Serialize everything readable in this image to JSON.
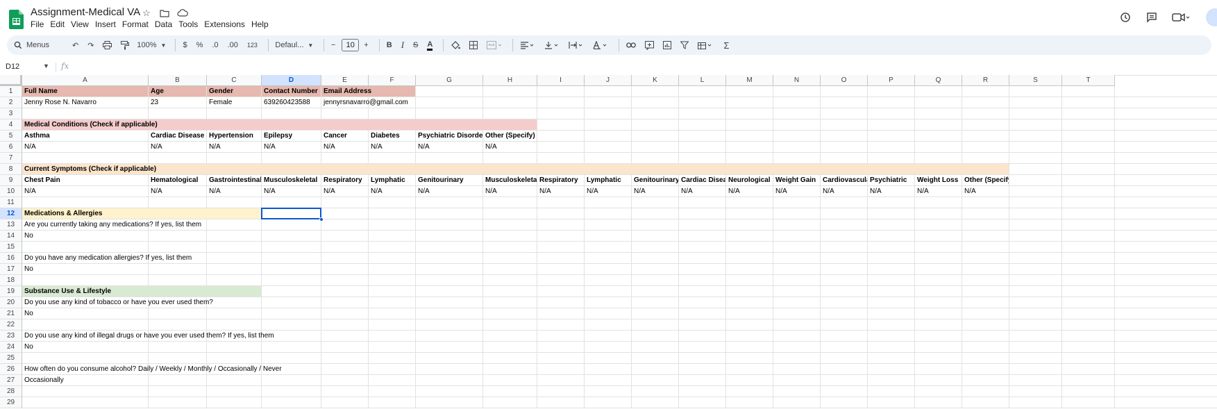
{
  "app": {
    "title": "Assignment-Medical VA",
    "menu": [
      "File",
      "Edit",
      "View",
      "Insert",
      "Format",
      "Data",
      "Tools",
      "Extensions",
      "Help"
    ]
  },
  "toolbar": {
    "search_label": "Menus",
    "zoom": "100%",
    "currency": "$",
    "percent": "%",
    "dec_decrease": ".0",
    "dec_increase": ".00",
    "number_format": "123",
    "font": "Defaul...",
    "font_size": "10",
    "bold": "B",
    "italic": "I",
    "strike": "S",
    "text_color": "A"
  },
  "formula_bar": {
    "cell_ref": "D12",
    "fx": "fx",
    "value": ""
  },
  "grid": {
    "columns": [
      "A",
      "B",
      "C",
      "D",
      "E",
      "F",
      "G",
      "H",
      "I",
      "J",
      "K",
      "L",
      "M",
      "N",
      "O",
      "P",
      "Q",
      "R",
      "S",
      "T"
    ],
    "selected_column": "D",
    "selected_row": 12,
    "rows": 29,
    "cells": [
      {
        "row": 1,
        "col": 0,
        "text": "Full Name",
        "bold": true,
        "fill": "red"
      },
      {
        "row": 1,
        "col": 1,
        "text": "Age",
        "bold": true,
        "fill": "red"
      },
      {
        "row": 1,
        "col": 2,
        "text": "Gender",
        "bold": true,
        "fill": "red"
      },
      {
        "row": 1,
        "col": 3,
        "text": "Contact Number",
        "bold": true,
        "fill": "red"
      },
      {
        "row": 1,
        "col": 4,
        "text": "Email Address",
        "bold": true,
        "fill": "red",
        "span": 2
      },
      {
        "row": 2,
        "col": 0,
        "text": "Jenny Rose N. Navarro"
      },
      {
        "row": 2,
        "col": 1,
        "text": "23"
      },
      {
        "row": 2,
        "col": 2,
        "text": "Female"
      },
      {
        "row": 2,
        "col": 3,
        "text": "639260423588"
      },
      {
        "row": 2,
        "col": 4,
        "text": "jennyrsnavarro@gmail.com",
        "overflow": true
      },
      {
        "row": 4,
        "col": 0,
        "text": "Medical Conditions (Check if applicable)",
        "bold": true,
        "fill": "pink",
        "span": 8
      },
      {
        "row": 5,
        "col": 0,
        "text": "Asthma",
        "bold": true
      },
      {
        "row": 5,
        "col": 1,
        "text": "Cardiac Disease",
        "bold": true
      },
      {
        "row": 5,
        "col": 2,
        "text": "Hypertension",
        "bold": true
      },
      {
        "row": 5,
        "col": 3,
        "text": "Epilepsy",
        "bold": true
      },
      {
        "row": 5,
        "col": 4,
        "text": "Cancer",
        "bold": true
      },
      {
        "row": 5,
        "col": 5,
        "text": "Diabetes",
        "bold": true
      },
      {
        "row": 5,
        "col": 6,
        "text": "Psychiatric Disorder",
        "bold": true
      },
      {
        "row": 5,
        "col": 7,
        "text": "Other (Specify)",
        "bold": true
      },
      {
        "row": 6,
        "col": 0,
        "text": "N/A"
      },
      {
        "row": 6,
        "col": 1,
        "text": "N/A"
      },
      {
        "row": 6,
        "col": 2,
        "text": "N/A"
      },
      {
        "row": 6,
        "col": 3,
        "text": "N/A"
      },
      {
        "row": 6,
        "col": 4,
        "text": "N/A"
      },
      {
        "row": 6,
        "col": 5,
        "text": "N/A"
      },
      {
        "row": 6,
        "col": 6,
        "text": "N/A"
      },
      {
        "row": 6,
        "col": 7,
        "text": "N/A"
      },
      {
        "row": 8,
        "col": 0,
        "text": "Current Symptoms (Check if applicable)",
        "bold": true,
        "fill": "orange",
        "span": 18
      },
      {
        "row": 9,
        "col": 0,
        "text": "Chest Pain",
        "bold": true
      },
      {
        "row": 9,
        "col": 1,
        "text": "Hematological",
        "bold": true
      },
      {
        "row": 9,
        "col": 2,
        "text": "Gastrointestinal",
        "bold": true
      },
      {
        "row": 9,
        "col": 3,
        "text": "Musculoskeletal",
        "bold": true
      },
      {
        "row": 9,
        "col": 4,
        "text": "Respiratory",
        "bold": true
      },
      {
        "row": 9,
        "col": 5,
        "text": "Lymphatic",
        "bold": true
      },
      {
        "row": 9,
        "col": 6,
        "text": "Genitourinary",
        "bold": true
      },
      {
        "row": 9,
        "col": 7,
        "text": "Musculoskeletal",
        "bold": true
      },
      {
        "row": 9,
        "col": 8,
        "text": "Respiratory",
        "bold": true
      },
      {
        "row": 9,
        "col": 9,
        "text": "Lymphatic",
        "bold": true
      },
      {
        "row": 9,
        "col": 10,
        "text": "Genitourinary",
        "bold": true
      },
      {
        "row": 9,
        "col": 11,
        "text": "Cardiac Disease",
        "bold": true
      },
      {
        "row": 9,
        "col": 12,
        "text": "Neurological",
        "bold": true
      },
      {
        "row": 9,
        "col": 13,
        "text": "Weight Gain",
        "bold": true
      },
      {
        "row": 9,
        "col": 14,
        "text": "Cardiovascular",
        "bold": true
      },
      {
        "row": 9,
        "col": 15,
        "text": "Psychiatric",
        "bold": true
      },
      {
        "row": 9,
        "col": 16,
        "text": "Weight Loss",
        "bold": true
      },
      {
        "row": 9,
        "col": 17,
        "text": "Other (Specify)",
        "bold": true
      },
      {
        "row": 10,
        "col": 0,
        "text": "N/A"
      },
      {
        "row": 10,
        "col": 1,
        "text": "N/A"
      },
      {
        "row": 10,
        "col": 2,
        "text": "N/A"
      },
      {
        "row": 10,
        "col": 3,
        "text": "N/A"
      },
      {
        "row": 10,
        "col": 4,
        "text": "N/A"
      },
      {
        "row": 10,
        "col": 5,
        "text": "N/A"
      },
      {
        "row": 10,
        "col": 6,
        "text": "N/A"
      },
      {
        "row": 10,
        "col": 7,
        "text": "N/A"
      },
      {
        "row": 10,
        "col": 8,
        "text": "N/A"
      },
      {
        "row": 10,
        "col": 9,
        "text": "N/A"
      },
      {
        "row": 10,
        "col": 10,
        "text": "N/A"
      },
      {
        "row": 10,
        "col": 11,
        "text": "N/A"
      },
      {
        "row": 10,
        "col": 12,
        "text": "N/A"
      },
      {
        "row": 10,
        "col": 13,
        "text": "N/A"
      },
      {
        "row": 10,
        "col": 14,
        "text": "N/A"
      },
      {
        "row": 10,
        "col": 15,
        "text": "N/A"
      },
      {
        "row": 10,
        "col": 16,
        "text": "N/A"
      },
      {
        "row": 10,
        "col": 17,
        "text": "N/A"
      },
      {
        "row": 12,
        "col": 0,
        "text": "Medications & Allergies",
        "bold": true,
        "fill": "yellow",
        "span": 3
      },
      {
        "row": 13,
        "col": 0,
        "text": "Are you currently taking any medications? If yes, list them",
        "overflow": true
      },
      {
        "row": 14,
        "col": 0,
        "text": "No"
      },
      {
        "row": 16,
        "col": 0,
        "text": "Do you have any medication allergies? If yes, list them",
        "overflow": true
      },
      {
        "row": 17,
        "col": 0,
        "text": "No"
      },
      {
        "row": 19,
        "col": 0,
        "text": "Substance Use & Lifestyle",
        "bold": true,
        "fill": "green",
        "span": 3
      },
      {
        "row": 20,
        "col": 0,
        "text": "Do you use any kind of tobacco or have you ever used them?",
        "overflow": true
      },
      {
        "row": 21,
        "col": 0,
        "text": "No"
      },
      {
        "row": 23,
        "col": 0,
        "text": "Do you use any kind of illegal drugs or have you ever used them? If yes, list them",
        "overflow": true
      },
      {
        "row": 24,
        "col": 0,
        "text": "No"
      },
      {
        "row": 26,
        "col": 0,
        "text": "How often do you consume alcohol? Daily / Weekly / Monthly / Occasionally / Never",
        "overflow": true
      },
      {
        "row": 27,
        "col": 0,
        "text": "Occasionally"
      }
    ]
  }
}
